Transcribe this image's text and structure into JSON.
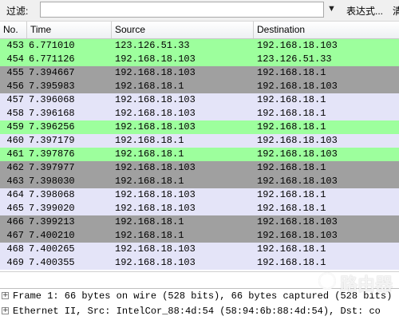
{
  "filter": {
    "label": "过滤:",
    "value": "",
    "dropdown_icon": "triangle-down",
    "expression_button": "表达式...",
    "more_button": "清"
  },
  "columns": [
    "No.",
    "Time",
    "Source",
    "Destination"
  ],
  "colors": {
    "green": "#9dff9d",
    "lavender": "#e4e4f8",
    "gray": "#a0a0a0"
  },
  "packets": [
    {
      "no": "453",
      "time": "6.771010",
      "source": "123.126.51.33",
      "destination": "192.168.18.103",
      "color": "green"
    },
    {
      "no": "454",
      "time": "6.771126",
      "source": "192.168.18.103",
      "destination": "123.126.51.33",
      "color": "green"
    },
    {
      "no": "455",
      "time": "7.394667",
      "source": "192.168.18.103",
      "destination": "192.168.18.1",
      "color": "gray"
    },
    {
      "no": "456",
      "time": "7.395983",
      "source": "192.168.18.1",
      "destination": "192.168.18.103",
      "color": "gray"
    },
    {
      "no": "457",
      "time": "7.396068",
      "source": "192.168.18.103",
      "destination": "192.168.18.1",
      "color": "lavender"
    },
    {
      "no": "458",
      "time": "7.396168",
      "source": "192.168.18.103",
      "destination": "192.168.18.1",
      "color": "lavender"
    },
    {
      "no": "459",
      "time": "7.396256",
      "source": "192.168.18.103",
      "destination": "192.168.18.1",
      "color": "green"
    },
    {
      "no": "460",
      "time": "7.397179",
      "source": "192.168.18.1",
      "destination": "192.168.18.103",
      "color": "lavender"
    },
    {
      "no": "461",
      "time": "7.397876",
      "source": "192.168.18.1",
      "destination": "192.168.18.103",
      "color": "green"
    },
    {
      "no": "462",
      "time": "7.397977",
      "source": "192.168.18.103",
      "destination": "192.168.18.1",
      "color": "gray"
    },
    {
      "no": "463",
      "time": "7.398030",
      "source": "192.168.18.1",
      "destination": "192.168.18.103",
      "color": "gray"
    },
    {
      "no": "464",
      "time": "7.398068",
      "source": "192.168.18.103",
      "destination": "192.168.18.1",
      "color": "lavender"
    },
    {
      "no": "465",
      "time": "7.399020",
      "source": "192.168.18.103",
      "destination": "192.168.18.1",
      "color": "lavender"
    },
    {
      "no": "466",
      "time": "7.399213",
      "source": "192.168.18.1",
      "destination": "192.168.18.103",
      "color": "gray"
    },
    {
      "no": "467",
      "time": "7.400210",
      "source": "192.168.18.1",
      "destination": "192.168.18.103",
      "color": "gray"
    },
    {
      "no": "468",
      "time": "7.400265",
      "source": "192.168.18.103",
      "destination": "192.168.18.1",
      "color": "lavender"
    },
    {
      "no": "469",
      "time": "7.400355",
      "source": "192.168.18.103",
      "destination": "192.168.18.1",
      "color": "lavender"
    }
  ],
  "details": [
    {
      "expander": "⊞",
      "text": "Frame 1: 66 bytes on wire (528 bits), 66 bytes captured (528 bits)"
    },
    {
      "expander": "⊞",
      "text": "Ethernet II, Src: IntelCor_88:4d:54 (58:94:6b:88:4d:54), Dst: co"
    }
  ],
  "watermark": {
    "text": "路由器",
    "icon": "router-logo"
  }
}
